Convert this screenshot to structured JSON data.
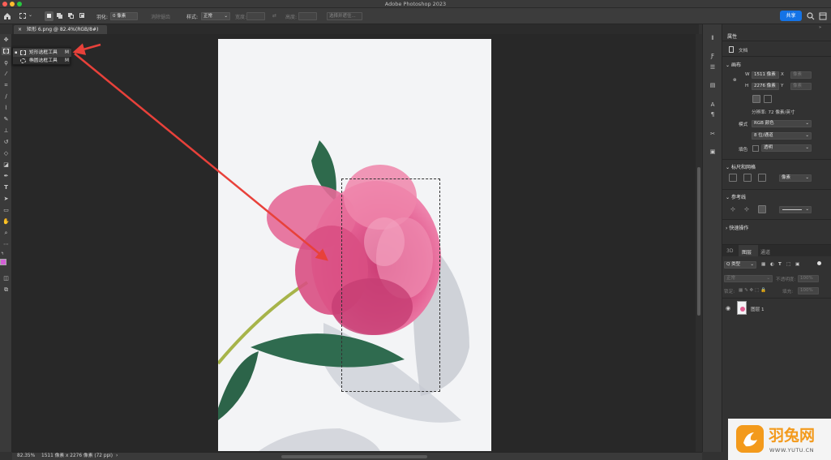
{
  "window": {
    "title": "Adobe Photoshop 2023",
    "traffic_colors": [
      "#fe5f57",
      "#febc2e",
      "#28c840"
    ]
  },
  "options_bar": {
    "feather_label": "羽化:",
    "feather_value": "0 像素",
    "anti_alias_label": "消除锯齿",
    "style_label": "样式:",
    "style_value": "正常",
    "width_label": "宽度:",
    "height_label": "高度:",
    "select_mask_label": "选择并遮住...",
    "share_label": "共享"
  },
  "document_tab": {
    "close": "×",
    "title": "矩形 6.png @ 82.4%(RGB/8#)"
  },
  "tool_flyout": {
    "items": [
      {
        "label": "矩形选框工具",
        "shortcut": "M"
      },
      {
        "label": "椭圆选框工具",
        "shortcut": "M"
      }
    ]
  },
  "properties": {
    "tab_label": "属性",
    "doc_label": "文档",
    "canvas_section": "画布",
    "w_label": "W",
    "w_value": "1511 像素",
    "x_label": "X",
    "x_placeholder": "像素",
    "h_label": "H",
    "h_value": "2276 像素",
    "y_label": "Y",
    "y_placeholder": "像素",
    "resolution": "分辨率: 72 像素/英寸",
    "mode_label": "模式",
    "mode_value": "RGB 颜色",
    "depth_value": "8 位/通道",
    "fill_label": "填色",
    "fill_value": "透明",
    "rulers_section": "标尺和网格",
    "rulers_unit": "像素",
    "guides_section": "参考线",
    "quick_actions_section": "快速操作"
  },
  "layers": {
    "tabs": [
      "3D",
      "图层",
      "通道"
    ],
    "filter_label": "Q 类型",
    "blend_mode": "正常",
    "opacity_label": "不透明度:",
    "opacity_value": "100%",
    "lock_label": "锁定:",
    "fill_label": "填充:",
    "fill_value": "100%",
    "layer_name": "图层 1"
  },
  "status": {
    "zoom": "82.35%",
    "doc_info": "1511 像素 x 2276 像素 (72 ppi)",
    "arrow": "›"
  },
  "watermark": {
    "brand": "羽兔网",
    "url": "WWW.YUTU.CN"
  },
  "colors": {
    "accent": "#1473e6",
    "annotation_arrow": "#e8413a",
    "foreground_swatch": "#d35fd6",
    "background_swatch": "#000000",
    "watermark_orange": "#f39a1c"
  }
}
